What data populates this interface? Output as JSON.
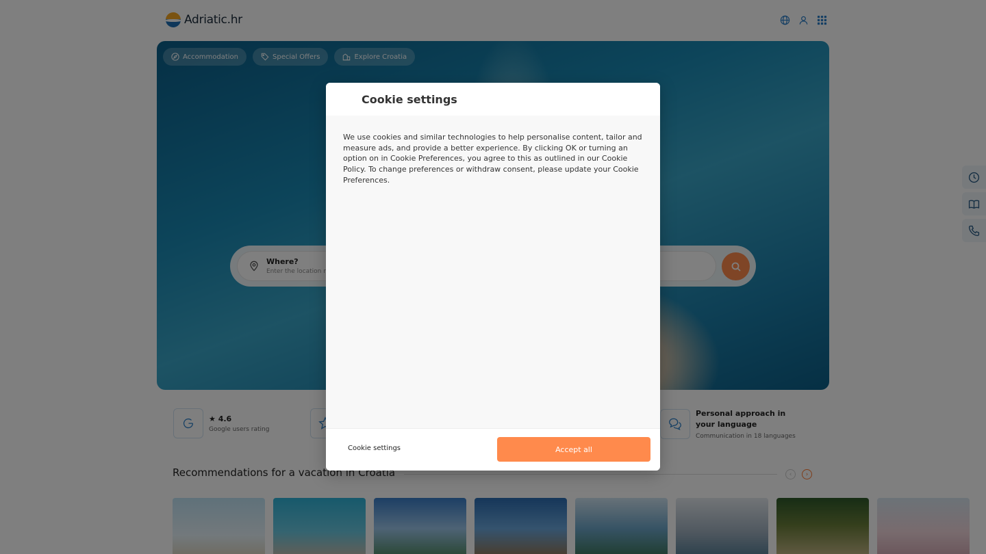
{
  "header": {
    "logo_text": "Adriatic.hr",
    "icons": [
      "globe-icon",
      "user-icon",
      "grid-icon"
    ]
  },
  "hero": {
    "tabs": [
      {
        "label": "Accommodation",
        "icon": "compass-icon"
      },
      {
        "label": "Special Offers",
        "icon": "tag-icon"
      },
      {
        "label": "Explore Croatia",
        "icon": "buildings-icon"
      }
    ],
    "search": {
      "where_label": "Where?",
      "where_placeholder": "Enter the location name"
    }
  },
  "side_buttons": [
    "clock-icon",
    "book-icon",
    "phone-icon"
  ],
  "trust": {
    "google": {
      "title": "4.6",
      "subtitle": "Google users rating"
    },
    "personal": {
      "title": "Personal approach in your language",
      "subtitle": "Communication in 18 languages"
    }
  },
  "recommendations": {
    "title": "Recommendations for a vacation in Croatia"
  },
  "cookie_modal": {
    "title": "Cookie settings",
    "body": "We use cookies and similar technologies to help personalise content, tailor and measure ads, and provide a better experience. By clicking OK or turning an option on in Cookie Preferences, you agree to this as outlined in our Cookie Policy. To change preferences or withdraw consent, please update your Cookie Preferences.",
    "settings_label": "Cookie settings",
    "accept_label": "Accept all"
  },
  "colors": {
    "accent": "#ff8a4c",
    "brand_blue": "#2b7fc9",
    "overlay": "rgba(0,0,0,0.5)"
  }
}
